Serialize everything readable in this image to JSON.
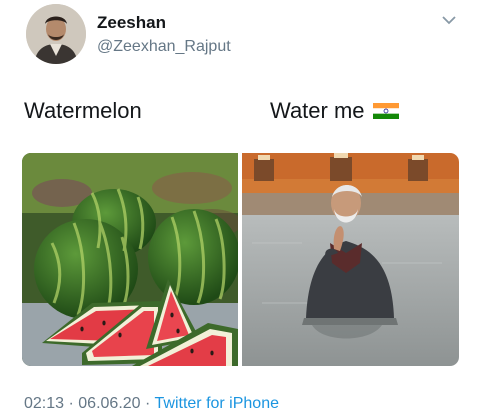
{
  "tweet": {
    "author_name": "Zeeshan",
    "author_handle": "@Zeexhan_Rajput",
    "caption_left": "Watermelon",
    "caption_right": "Water me",
    "caption_right_emoji": "india-flag-icon",
    "left_image_subject": "watermelons-photo",
    "right_image_subject": "man-in-river-photo",
    "time": "02:13",
    "separator": "·",
    "date": "06.06.20",
    "source": "Twitter for iPhone"
  },
  "colors": {
    "text": "#14171a",
    "secondary": "#657786",
    "link": "#1b95e0"
  }
}
